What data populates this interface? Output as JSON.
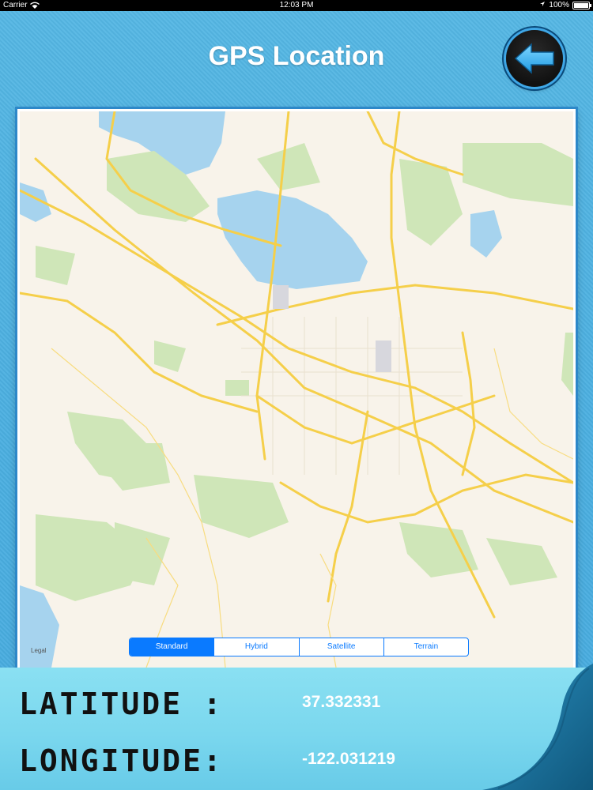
{
  "status_bar": {
    "carrier": "Carrier",
    "time": "12:03 PM",
    "battery": "100%"
  },
  "header": {
    "title": "GPS Location",
    "back_icon": "back-arrow-icon"
  },
  "map": {
    "legal": "Legal",
    "map_types": [
      "Standard",
      "Hybrid",
      "Satellite",
      "Terrain"
    ],
    "selected_type": "Standard"
  },
  "coordinates": {
    "latitude_label": "LATITUDE :",
    "latitude_value": "37.332331",
    "longitude_label": "LONGITUDE:",
    "longitude_value": "-122.031219"
  },
  "colors": {
    "background": "#4fb2e1",
    "accent": "#0a7aff",
    "road": "#f5cf4a",
    "water": "#a6d3ee",
    "park": "#cfe6b8"
  }
}
